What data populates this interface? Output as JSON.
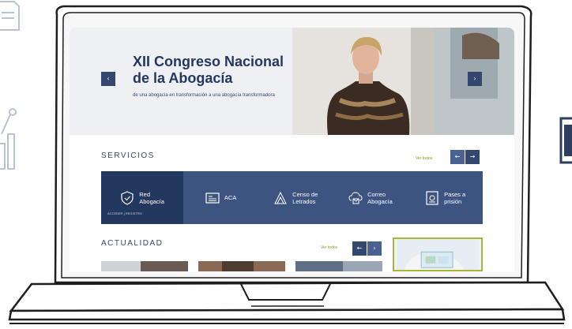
{
  "hero": {
    "title": "XII Congreso Nacional de la Abogacía",
    "subtitle": "de una abogacía en transformación a una abogacía transformadora",
    "prev_icon": "chevron-left-icon",
    "next_icon": "chevron-right-icon"
  },
  "services": {
    "heading": "SERVICIOS",
    "see_all": "Ver todos",
    "items": [
      {
        "label": "Red\nAbogacía",
        "icon": "shield-hand-icon",
        "tag": "ACCEDER | REGISTRO"
      },
      {
        "label": "ACA",
        "icon": "id-card-icon"
      },
      {
        "label": "Censo de\nLetrados",
        "icon": "people-icon"
      },
      {
        "label": "Correo\nAbogacía",
        "icon": "mail-icon"
      },
      {
        "label": "Pases a\nprisión",
        "icon": "document-badge-icon"
      }
    ]
  },
  "news": {
    "heading": "ACTUALIDAD",
    "see_all": "Ver todos"
  },
  "colors": {
    "navy": "#23385f",
    "strip": "#3d5480",
    "accent_green": "#a8b635"
  }
}
